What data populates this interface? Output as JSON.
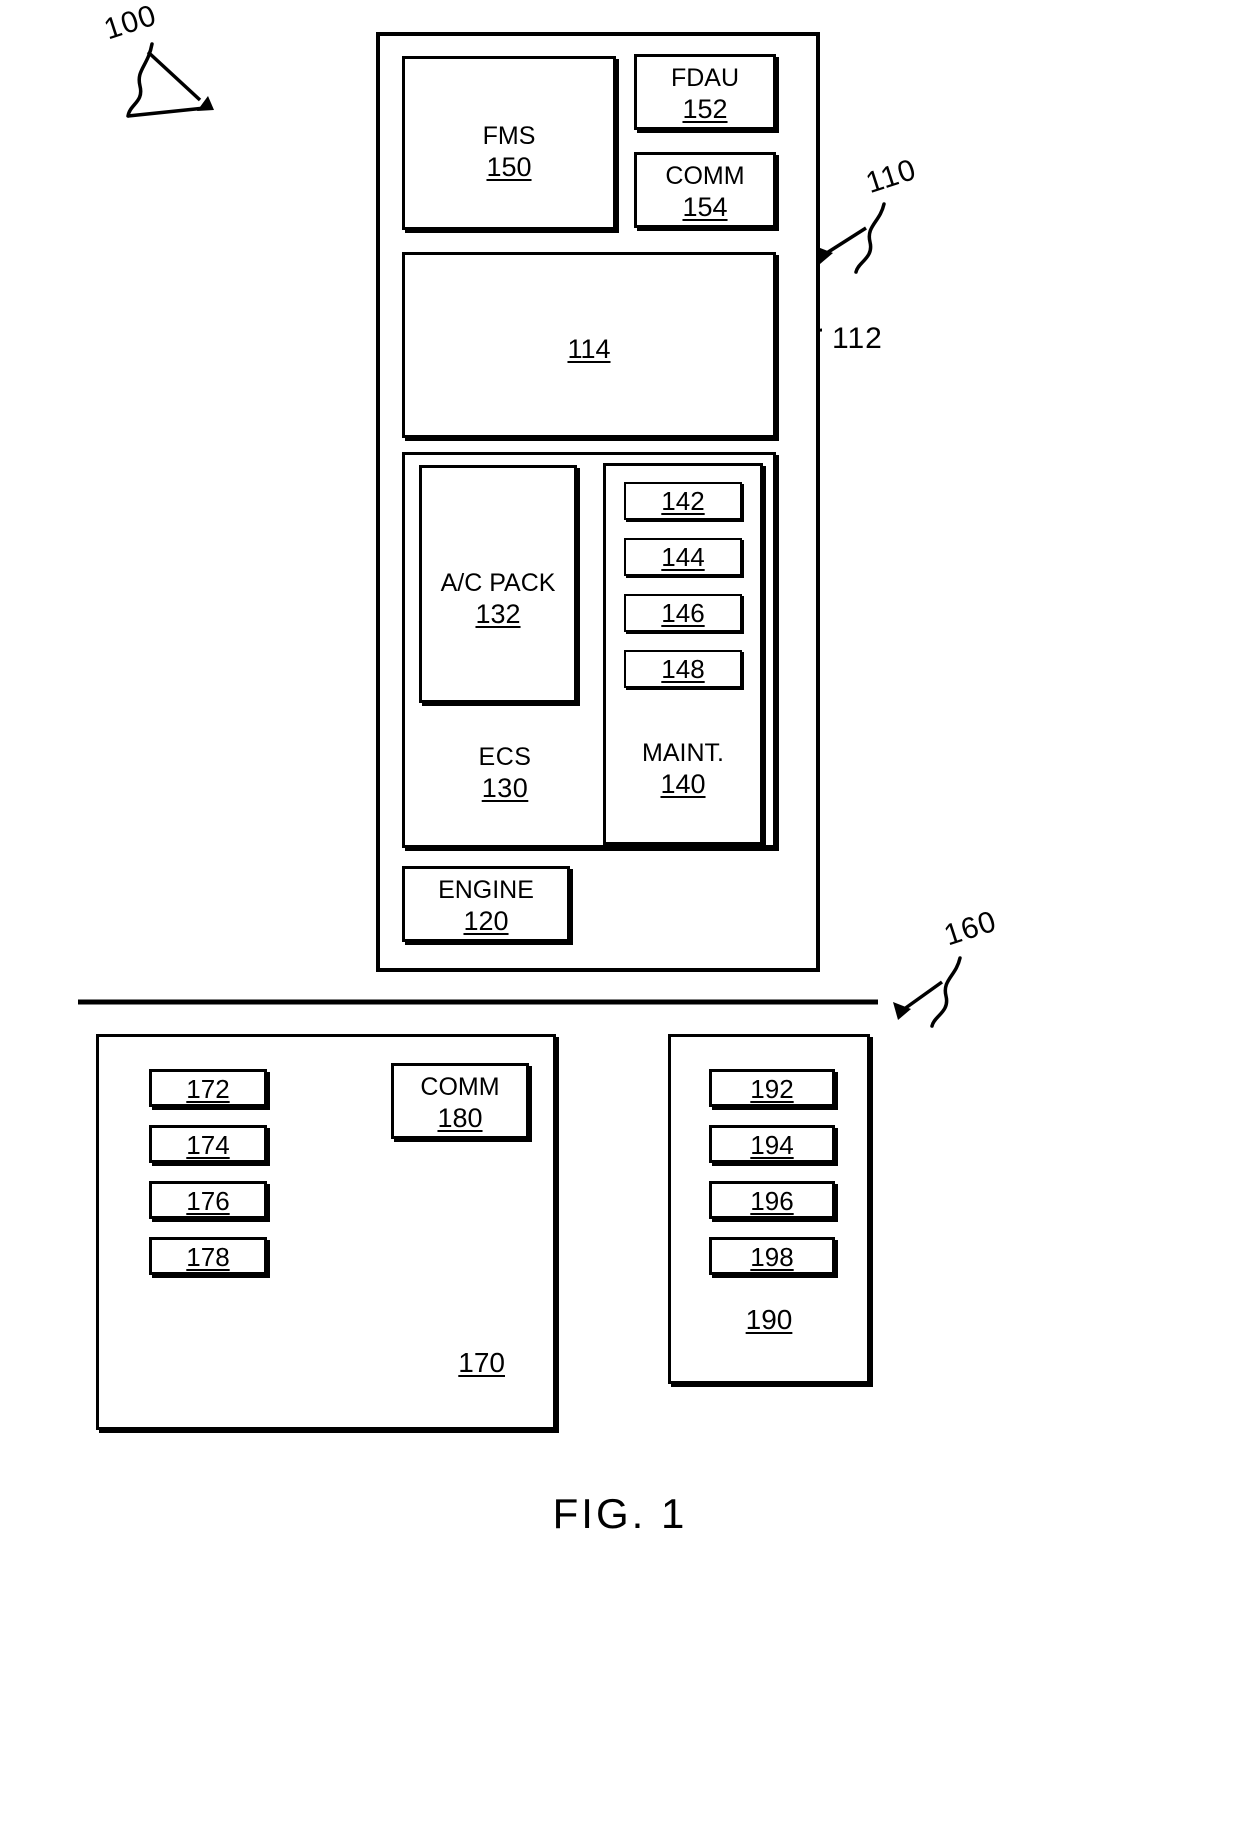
{
  "figure": {
    "caption": "FIG. 1",
    "system_ref": "100"
  },
  "aircraft_domain": {
    "ref": "110",
    "inner_ref": "112",
    "network_box": {
      "ref": "114"
    },
    "fms": {
      "label": "FMS",
      "ref": "150"
    },
    "fdau": {
      "label": "FDAU",
      "ref": "152"
    },
    "comm": {
      "label": "COMM",
      "ref": "154"
    },
    "ecs": {
      "label": "ECS",
      "ref": "130",
      "ac_pack": {
        "label": "A/C PACK",
        "ref": "132"
      }
    },
    "maint": {
      "label": "MAINT.",
      "ref": "140",
      "items": [
        {
          "ref": "142"
        },
        {
          "ref": "144"
        },
        {
          "ref": "146"
        },
        {
          "ref": "148"
        }
      ]
    },
    "engine": {
      "label": "ENGINE",
      "ref": "120"
    }
  },
  "ground_domain": {
    "ref": "160",
    "ground_system": {
      "ref": "170",
      "items": [
        {
          "ref": "172"
        },
        {
          "ref": "174"
        },
        {
          "ref": "176"
        },
        {
          "ref": "178"
        }
      ],
      "comm": {
        "label": "COMM",
        "ref": "180"
      }
    },
    "remote_system": {
      "ref": "190",
      "items": [
        {
          "ref": "192"
        },
        {
          "ref": "194"
        },
        {
          "ref": "196"
        },
        {
          "ref": "198"
        }
      ]
    }
  }
}
